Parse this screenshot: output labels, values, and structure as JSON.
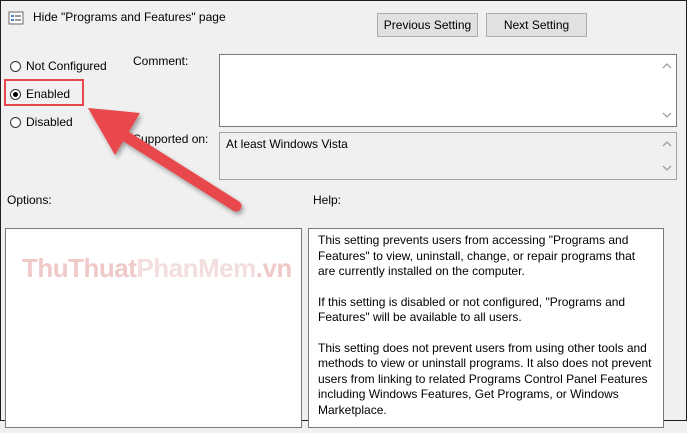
{
  "window": {
    "title": "Hide \"Programs and Features\" page"
  },
  "nav": {
    "previous_label": "Previous Setting",
    "next_label": "Next Setting"
  },
  "state": {
    "options": [
      {
        "label": "Not Configured",
        "selected": false
      },
      {
        "label": "Enabled",
        "selected": true
      },
      {
        "label": "Disabled",
        "selected": false
      }
    ]
  },
  "comment": {
    "label": "Comment:",
    "value": ""
  },
  "supported": {
    "label": "Supported on:",
    "value": "At least Windows Vista"
  },
  "options_panel": {
    "label": "Options:"
  },
  "help": {
    "label": "Help:",
    "paragraphs": [
      "This setting prevents users from accessing \"Programs and Features\" to view, uninstall, change, or repair programs that are currently installed on the computer.",
      "If this setting is disabled or not configured, \"Programs and Features\" will be available to all users.",
      "This setting does not prevent users from using other tools and methods to view or uninstall programs.  It also does not prevent users from linking to related Programs Control Panel Features including Windows Features, Get Programs, or Windows Marketplace."
    ]
  },
  "watermark": {
    "part1": "ThuThuat",
    "part2": "PhanMem",
    "part3": ".vn"
  },
  "annotation": {
    "color": "#e8474b"
  }
}
